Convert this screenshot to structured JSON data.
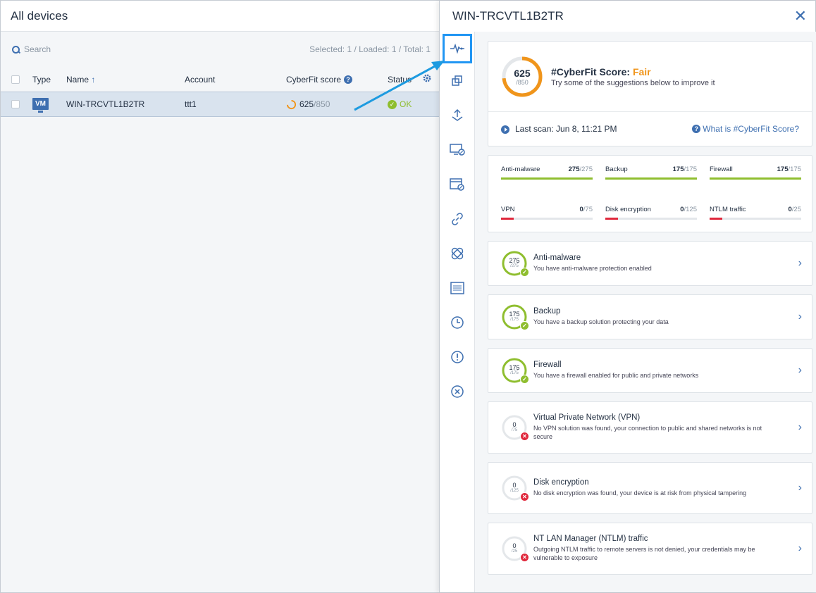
{
  "left": {
    "title": "All devices",
    "search_placeholder": "Search",
    "counter": "Selected: 1 / Loaded: 1 / Total: 1",
    "columns": {
      "type": "Type",
      "name": "Name",
      "account": "Account",
      "score": "CyberFit score",
      "status": "Status"
    },
    "row": {
      "type": "VM",
      "name": "WIN-TRCVTL1B2TR",
      "account": "ttt1",
      "score": "625",
      "score_max": "/850",
      "status": "OK"
    }
  },
  "panel": {
    "title": "WIN-TRCVTL1B2TR",
    "score": {
      "value": "625",
      "max": "/850",
      "fraction": 0.735,
      "label": "#CyberFit Score:",
      "rating": "Fair",
      "subtitle": "Try some of the suggestions below to improve it"
    },
    "last_scan": "Last scan: Jun 8, 11:21 PM",
    "what_is": "What is #CyberFit Score?",
    "metrics": [
      {
        "label": "Anti-malware",
        "value": "275",
        "max": "/275",
        "fraction": 1.0,
        "color": "#8fbe2f"
      },
      {
        "label": "Backup",
        "value": "175",
        "max": "/175",
        "fraction": 1.0,
        "color": "#8fbe2f"
      },
      {
        "label": "Firewall",
        "value": "175",
        "max": "/175",
        "fraction": 1.0,
        "color": "#8fbe2f"
      },
      {
        "label": "VPN",
        "value": "0",
        "max": "/75",
        "fraction": 0.0,
        "color": "#e0283c"
      },
      {
        "label": "Disk encryption",
        "value": "0",
        "max": "/125",
        "fraction": 0.0,
        "color": "#e0283c"
      },
      {
        "label": "NTLM traffic",
        "value": "0",
        "max": "/25",
        "fraction": 0.0,
        "color": "#e0283c"
      }
    ],
    "items": [
      {
        "title": "Anti-malware",
        "desc": "You have anti-malware protection enabled",
        "value": "275",
        "max": "/275",
        "ok": true
      },
      {
        "title": "Backup",
        "desc": "You have a backup solution protecting your data",
        "value": "175",
        "max": "/175",
        "ok": true
      },
      {
        "title": "Firewall",
        "desc": "You have a firewall enabled for public and private networks",
        "value": "175",
        "max": "/175",
        "ok": true
      },
      {
        "title": "Virtual Private Network (VPN)",
        "desc": "No VPN solution was found, your connection to public and shared networks is not secure",
        "value": "0",
        "max": "/75",
        "ok": false
      },
      {
        "title": "Disk encryption",
        "desc": "No disk encryption was found, your device is at risk from physical tampering",
        "value": "0",
        "max": "/125",
        "ok": false
      },
      {
        "title": "NT LAN Manager (NTLM) traffic",
        "desc": "Outgoing NTLM traffic to remote servers is not denied, your credentials may be vulnerable to exposure",
        "value": "0",
        "max": "/25",
        "ok": false
      }
    ],
    "icons": [
      "pulse-icon",
      "copy-icon",
      "recovery-icon",
      "monitor-shield-icon",
      "window-shield-icon",
      "link-icon",
      "patch-icon",
      "list-icon",
      "clock-icon",
      "alert-icon",
      "cancel-icon"
    ]
  }
}
